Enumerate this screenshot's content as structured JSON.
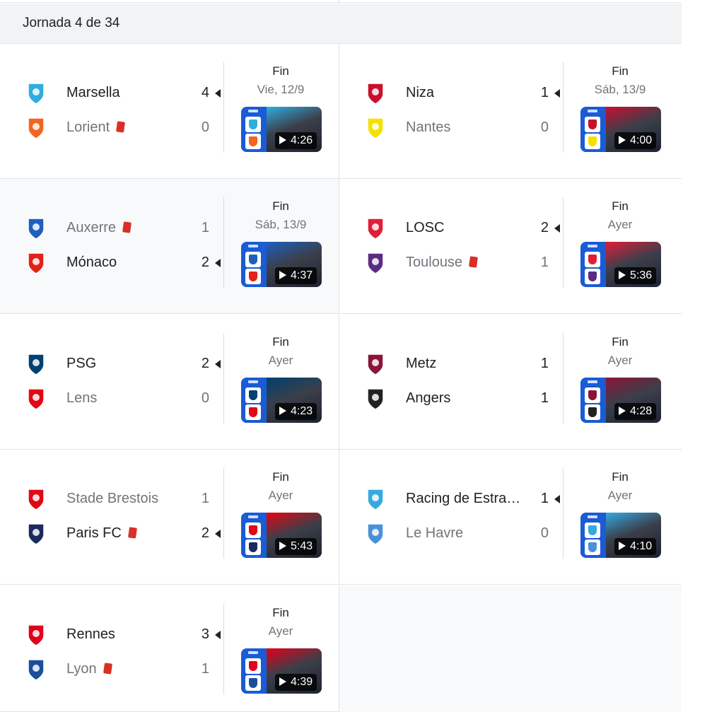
{
  "header": {
    "round_label": "Jornada 4 de 34"
  },
  "matches": [
    {
      "home": {
        "name": "Marsella",
        "score": "4",
        "winner": true,
        "red_card": false,
        "crest": "marseille-crest",
        "color": "#2FAEE0"
      },
      "away": {
        "name": "Lorient",
        "score": "0",
        "winner": false,
        "red_card": true,
        "crest": "lorient-crest",
        "color": "#F26522"
      },
      "status": "Fin",
      "date": "Vie, 12/9",
      "duration": "4:26",
      "arrow": "home"
    },
    {
      "home": {
        "name": "Niza",
        "score": "1",
        "winner": true,
        "red_card": false,
        "crest": "nice-crest",
        "color": "#C8102E"
      },
      "away": {
        "name": "Nantes",
        "score": "0",
        "winner": false,
        "red_card": false,
        "crest": "nantes-crest",
        "color": "#F5E100"
      },
      "status": "Fin",
      "date": "Sáb, 13/9",
      "duration": "4:00",
      "arrow": "home"
    },
    {
      "home": {
        "name": "Auxerre",
        "score": "1",
        "winner": false,
        "red_card": true,
        "crest": "auxerre-crest",
        "color": "#1E5FBF"
      },
      "away": {
        "name": "Mónaco",
        "score": "2",
        "winner": true,
        "red_card": false,
        "crest": "monaco-crest",
        "color": "#E2231A"
      },
      "status": "Fin",
      "date": "Sáb, 13/9",
      "duration": "4:37",
      "arrow": "away"
    },
    {
      "home": {
        "name": "LOSC",
        "score": "2",
        "winner": true,
        "red_card": false,
        "crest": "losc-crest",
        "color": "#E01E37"
      },
      "away": {
        "name": "Toulouse",
        "score": "1",
        "winner": false,
        "red_card": true,
        "crest": "toulouse-crest",
        "color": "#5B2C83"
      },
      "status": "Fin",
      "date": "Ayer",
      "duration": "5:36",
      "arrow": "home"
    },
    {
      "home": {
        "name": "PSG",
        "score": "2",
        "winner": true,
        "red_card": false,
        "crest": "psg-crest",
        "color": "#004170"
      },
      "away": {
        "name": "Lens",
        "score": "0",
        "winner": false,
        "red_card": false,
        "crest": "lens-crest",
        "color": "#E30613"
      },
      "status": "Fin",
      "date": "Ayer",
      "duration": "4:23",
      "arrow": "home"
    },
    {
      "home": {
        "name": "Metz",
        "score": "1",
        "winner": true,
        "red_card": false,
        "crest": "metz-crest",
        "color": "#8A1538"
      },
      "away": {
        "name": "Angers",
        "score": "1",
        "winner": true,
        "red_card": false,
        "crest": "angers-crest",
        "color": "#222222"
      },
      "status": "Fin",
      "date": "Ayer",
      "duration": "4:28",
      "arrow": "none"
    },
    {
      "home": {
        "name": "Stade Brestois",
        "score": "1",
        "winner": false,
        "red_card": false,
        "crest": "brest-crest",
        "color": "#E30613"
      },
      "away": {
        "name": "Paris FC",
        "score": "2",
        "winner": true,
        "red_card": true,
        "crest": "parisfc-crest",
        "color": "#1B2A5E"
      },
      "status": "Fin",
      "date": "Ayer",
      "duration": "5:43",
      "arrow": "away"
    },
    {
      "home": {
        "name": "Racing de Estra…",
        "score": "1",
        "winner": true,
        "red_card": false,
        "crest": "strasbourg-crest",
        "color": "#36A9E1"
      },
      "away": {
        "name": "Le Havre",
        "score": "0",
        "winner": false,
        "red_card": false,
        "crest": "lehavre-crest",
        "color": "#4A90D9"
      },
      "status": "Fin",
      "date": "Ayer",
      "duration": "4:10",
      "arrow": "home"
    },
    {
      "home": {
        "name": "Rennes",
        "score": "3",
        "winner": true,
        "red_card": false,
        "crest": "rennes-crest",
        "color": "#E2001A"
      },
      "away": {
        "name": "Lyon",
        "score": "1",
        "winner": false,
        "red_card": true,
        "crest": "lyon-crest",
        "color": "#1B4F9C"
      },
      "status": "Fin",
      "date": "Ayer",
      "duration": "4:39",
      "arrow": "home"
    }
  ]
}
